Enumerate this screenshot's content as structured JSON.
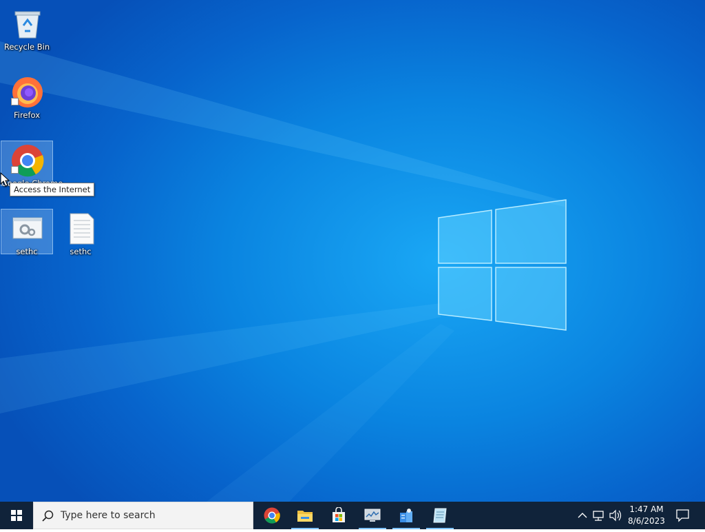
{
  "desktop": {
    "icons": [
      {
        "label": "Recycle Bin",
        "icon": "recycle-bin-icon"
      },
      {
        "label": "Firefox",
        "icon": "firefox-icon"
      },
      {
        "label": "Google Chrome",
        "icon": "chrome-icon"
      },
      {
        "label": "sethc",
        "icon": "settings-program-icon"
      },
      {
        "label": "sethc",
        "icon": "text-document-icon"
      }
    ],
    "tooltip": "Access the Internet"
  },
  "taskbar": {
    "search_placeholder": "Type here to search",
    "apps": [
      {
        "name": "Google Chrome",
        "icon": "chrome-icon"
      },
      {
        "name": "File Explorer",
        "icon": "folder-icon"
      },
      {
        "name": "Microsoft Store",
        "icon": "store-icon"
      },
      {
        "name": "Task Manager",
        "icon": "monitor-icon"
      },
      {
        "name": "Server Manager",
        "icon": "server-manager-icon"
      },
      {
        "name": "Notepad",
        "icon": "notepad-icon"
      }
    ],
    "clock": {
      "time": "1:47 AM",
      "date": "8/6/2023"
    }
  },
  "colors": {
    "taskbar": "#10233a",
    "accent": "#0a84e0"
  }
}
